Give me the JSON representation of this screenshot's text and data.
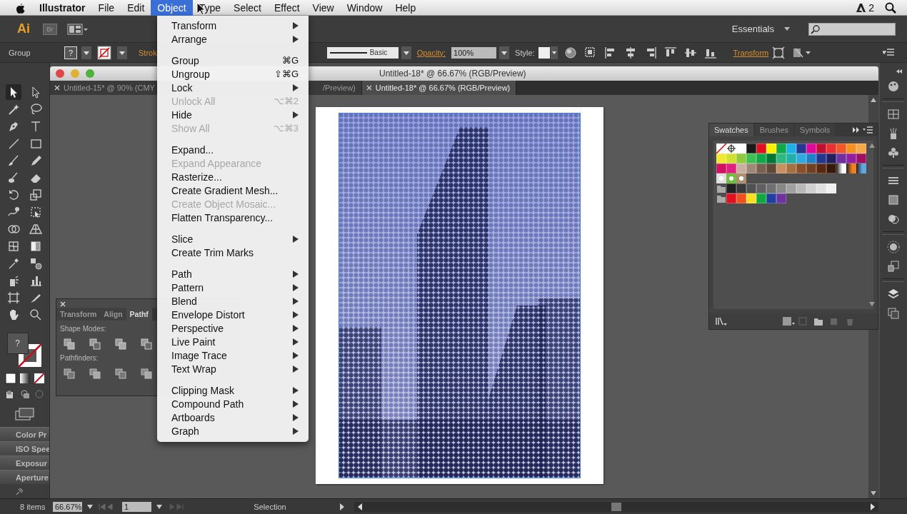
{
  "menubar": {
    "items": [
      {
        "label": "Illustrator",
        "selected": false,
        "kind": "app"
      },
      {
        "label": "File",
        "selected": false,
        "kind": "menu"
      },
      {
        "label": "Edit",
        "selected": false,
        "kind": "menu"
      },
      {
        "label": "Object",
        "selected": true,
        "kind": "menu"
      },
      {
        "label": "Type",
        "selected": false,
        "kind": "menu"
      },
      {
        "label": "Select",
        "selected": false,
        "kind": "menu"
      },
      {
        "label": "Effect",
        "selected": false,
        "kind": "menu"
      },
      {
        "label": "View",
        "selected": false,
        "kind": "menu"
      },
      {
        "label": "Window",
        "selected": false,
        "kind": "menu"
      },
      {
        "label": "Help",
        "selected": false,
        "kind": "menu"
      }
    ],
    "badge": "2"
  },
  "app_bar": {
    "logo": "Ai",
    "bridge": "Br",
    "workspace": "Essentials"
  },
  "control_bar": {
    "selection": "Group",
    "fill_label": "?",
    "stroke_label": "Strok",
    "stroke_profile": "Basic",
    "opacity_label": "Opacity:",
    "opacity": "100%",
    "style_label": "Style:",
    "transform_link": "Transform"
  },
  "object_menu": {
    "items": [
      {
        "kind": "item",
        "label": "Transform",
        "submenu": true,
        "disabled": false
      },
      {
        "kind": "item",
        "label": "Arrange",
        "submenu": true,
        "disabled": false
      },
      {
        "kind": "separator"
      },
      {
        "kind": "item",
        "label": "Group",
        "shortcut": "⌘G",
        "submenu": false,
        "disabled": false
      },
      {
        "kind": "item",
        "label": "Ungroup",
        "shortcut": "⇧⌘G",
        "submenu": false,
        "disabled": false
      },
      {
        "kind": "item",
        "label": "Lock",
        "submenu": true,
        "disabled": false
      },
      {
        "kind": "item",
        "label": "Unlock All",
        "shortcut": "⌥⌘2",
        "submenu": false,
        "disabled": true
      },
      {
        "kind": "item",
        "label": "Hide",
        "submenu": true,
        "disabled": false
      },
      {
        "kind": "item",
        "label": "Show All",
        "shortcut": "⌥⌘3",
        "submenu": false,
        "disabled": true
      },
      {
        "kind": "separator"
      },
      {
        "kind": "item",
        "label": "Expand...",
        "submenu": false,
        "disabled": false
      },
      {
        "kind": "item",
        "label": "Expand Appearance",
        "submenu": false,
        "disabled": true
      },
      {
        "kind": "item",
        "label": "Rasterize...",
        "submenu": false,
        "disabled": false
      },
      {
        "kind": "item",
        "label": "Create Gradient Mesh...",
        "submenu": false,
        "disabled": false
      },
      {
        "kind": "item",
        "label": "Create Object Mosaic...",
        "submenu": false,
        "disabled": true
      },
      {
        "kind": "item",
        "label": "Flatten Transparency...",
        "submenu": false,
        "disabled": false
      },
      {
        "kind": "separator"
      },
      {
        "kind": "item",
        "label": "Slice",
        "submenu": true,
        "disabled": false
      },
      {
        "kind": "item",
        "label": "Create Trim Marks",
        "submenu": false,
        "disabled": false
      },
      {
        "kind": "separator"
      },
      {
        "kind": "item",
        "label": "Path",
        "submenu": true,
        "disabled": false
      },
      {
        "kind": "item",
        "label": "Pattern",
        "submenu": true,
        "disabled": false
      },
      {
        "kind": "item",
        "label": "Blend",
        "submenu": true,
        "disabled": false
      },
      {
        "kind": "item",
        "label": "Envelope Distort",
        "submenu": true,
        "disabled": false
      },
      {
        "kind": "item",
        "label": "Perspective",
        "submenu": true,
        "disabled": false
      },
      {
        "kind": "item",
        "label": "Live Paint",
        "submenu": true,
        "disabled": false
      },
      {
        "kind": "item",
        "label": "Image Trace",
        "submenu": true,
        "disabled": false
      },
      {
        "kind": "item",
        "label": "Text Wrap",
        "submenu": true,
        "disabled": false
      },
      {
        "kind": "separator"
      },
      {
        "kind": "item",
        "label": "Clipping Mask",
        "submenu": true,
        "disabled": false
      },
      {
        "kind": "item",
        "label": "Compound Path",
        "submenu": true,
        "disabled": false
      },
      {
        "kind": "item",
        "label": "Artboards",
        "submenu": true,
        "disabled": false
      },
      {
        "kind": "item",
        "label": "Graph",
        "submenu": true,
        "disabled": false
      }
    ]
  },
  "document": {
    "title": "Untitled-18* @ 66.67% (RGB/Preview)",
    "tabs": [
      {
        "label": "Untitled-15* @ 90% (CMY",
        "tail": "/Preview)",
        "selected": false
      },
      {
        "label": "Untitled-18* @ 66.67% (RGB/Preview)",
        "selected": true
      }
    ]
  },
  "toolbox": {
    "fill_label": "?",
    "tools": [
      {
        "kind": "select",
        "selected": true
      },
      {
        "kind": "direct",
        "selected": false
      },
      {
        "kind": "wand",
        "selected": false
      },
      {
        "kind": "lasso",
        "selected": false
      },
      {
        "kind": "pen",
        "selected": false
      },
      {
        "kind": "type",
        "selected": false
      },
      {
        "kind": "line",
        "selected": false
      },
      {
        "kind": "rect",
        "selected": false
      },
      {
        "kind": "brush",
        "selected": false
      },
      {
        "kind": "pencil",
        "selected": false
      },
      {
        "kind": "blob",
        "selected": false
      },
      {
        "kind": "eraser",
        "selected": false
      },
      {
        "kind": "rotate",
        "selected": false
      },
      {
        "kind": "scale",
        "selected": false
      },
      {
        "kind": "warp",
        "selected": false
      },
      {
        "kind": "freetransform",
        "selected": false
      },
      {
        "kind": "shapebuilder",
        "selected": false
      },
      {
        "kind": "perspective",
        "selected": false
      },
      {
        "kind": "mesh",
        "selected": false
      },
      {
        "kind": "gradient",
        "selected": false
      },
      {
        "kind": "eyedropper",
        "selected": false
      },
      {
        "kind": "blend",
        "selected": false
      },
      {
        "kind": "symbol",
        "selected": false
      },
      {
        "kind": "graph",
        "selected": false
      },
      {
        "kind": "artboard",
        "selected": false
      },
      {
        "kind": "slice",
        "selected": false
      },
      {
        "kind": "hand",
        "selected": false
      },
      {
        "kind": "zoom",
        "selected": false
      }
    ]
  },
  "collapsed_panels": [
    "Color Pr",
    "ISO Spee",
    "Exposur",
    "Aperture"
  ],
  "pathfinder_panel": {
    "tabs": [
      {
        "label": "Transform",
        "selected": false
      },
      {
        "label": "Align",
        "selected": false
      },
      {
        "label": "Pathf",
        "selected": true
      }
    ],
    "shape_modes_label": "Shape Modes:",
    "pathfinders_label": "Pathfinders:"
  },
  "swatches_panel": {
    "tabs": [
      {
        "label": "Swatches",
        "selected": true
      },
      {
        "label": "Brushes",
        "selected": false
      },
      {
        "label": "Symbols",
        "selected": false
      }
    ],
    "rows": [
      {
        "folder": false,
        "swatches": [
          {
            "kind": "none"
          },
          {
            "kind": "registration"
          },
          {
            "kind": "color",
            "color": "#ffffff"
          },
          {
            "kind": "color",
            "color": "#1a1a1a"
          },
          {
            "kind": "color",
            "color": "#e01020"
          },
          {
            "kind": "color",
            "color": "#fff000"
          },
          {
            "kind": "color",
            "color": "#10a848"
          },
          {
            "kind": "color",
            "color": "#20b0e8"
          },
          {
            "kind": "color",
            "color": "#283890"
          },
          {
            "kind": "color",
            "color": "#e0089a"
          },
          {
            "kind": "color",
            "color": "#c01030"
          },
          {
            "kind": "color",
            "color": "#e83030"
          },
          {
            "kind": "color",
            "color": "#f05828"
          },
          {
            "kind": "color",
            "color": "#f49020"
          },
          {
            "kind": "color",
            "color": "#f8a848"
          }
        ]
      },
      {
        "folder": false,
        "swatches": [
          {
            "kind": "color",
            "color": "#f0e830"
          },
          {
            "kind": "color",
            "color": "#d0e030"
          },
          {
            "kind": "color",
            "color": "#90c840"
          },
          {
            "kind": "color",
            "color": "#40c050"
          },
          {
            "kind": "color",
            "color": "#10a848"
          },
          {
            "kind": "color",
            "color": "#007838"
          },
          {
            "kind": "color",
            "color": "#30b880"
          },
          {
            "kind": "color",
            "color": "#20b0a8"
          },
          {
            "kind": "color",
            "color": "#30a8e0"
          },
          {
            "kind": "color",
            "color": "#2080c8"
          },
          {
            "kind": "color",
            "color": "#203890"
          },
          {
            "kind": "color",
            "color": "#202060"
          },
          {
            "kind": "color",
            "color": "#7030a0"
          },
          {
            "kind": "color",
            "color": "#9020a0"
          },
          {
            "kind": "color",
            "color": "#a01060"
          }
        ]
      },
      {
        "folder": false,
        "swatches": [
          {
            "kind": "color",
            "color": "#d01060"
          },
          {
            "kind": "color",
            "color": "#e02080"
          },
          {
            "kind": "color",
            "color": "#c8b0a0"
          },
          {
            "kind": "color",
            "color": "#a08878"
          },
          {
            "kind": "color",
            "color": "#786050"
          },
          {
            "kind": "color",
            "color": "#604838"
          },
          {
            "kind": "color",
            "color": "#c89060"
          },
          {
            "kind": "color",
            "color": "#a87040"
          },
          {
            "kind": "color",
            "color": "#885028"
          },
          {
            "kind": "color",
            "color": "#704020"
          },
          {
            "kind": "color",
            "color": "#582810"
          },
          {
            "kind": "color",
            "color": "#381808"
          },
          {
            "kind": "gradient",
            "color": "#ffffff"
          },
          {
            "kind": "gradient",
            "color": "#f08020"
          },
          {
            "kind": "gradient",
            "color": "#60a8e0"
          }
        ]
      },
      {
        "folder": false,
        "swatches": [
          {
            "kind": "pattern",
            "color": "#e0e0e0"
          },
          {
            "kind": "pattern",
            "color": "#70c040"
          },
          {
            "kind": "pattern",
            "color": "#b09070"
          }
        ]
      },
      {
        "folder": true,
        "swatches": [
          {
            "kind": "color",
            "color": "#202020"
          },
          {
            "kind": "color",
            "color": "#383838"
          },
          {
            "kind": "color",
            "color": "#505050"
          },
          {
            "kind": "color",
            "color": "#606060"
          },
          {
            "kind": "color",
            "color": "#707070"
          },
          {
            "kind": "color",
            "color": "#888888"
          },
          {
            "kind": "color",
            "color": "#a0a0a0"
          },
          {
            "kind": "color",
            "color": "#b8b8b8"
          },
          {
            "kind": "color",
            "color": "#d0d0d0"
          },
          {
            "kind": "color",
            "color": "#e0e0e0"
          },
          {
            "kind": "color",
            "color": "#f0f0f0"
          }
        ]
      },
      {
        "folder": true,
        "swatches": [
          {
            "kind": "color",
            "color": "#e01020"
          },
          {
            "kind": "color",
            "color": "#f05020"
          },
          {
            "kind": "color",
            "color": "#f8e020"
          },
          {
            "kind": "color",
            "color": "#10a840"
          },
          {
            "kind": "color",
            "color": "#2040a0"
          },
          {
            "kind": "color",
            "color": "#7030a0"
          }
        ]
      }
    ]
  },
  "status_bar": {
    "items": "8 items",
    "zoom": "66.67%",
    "page": "1",
    "tool": "Selection"
  }
}
